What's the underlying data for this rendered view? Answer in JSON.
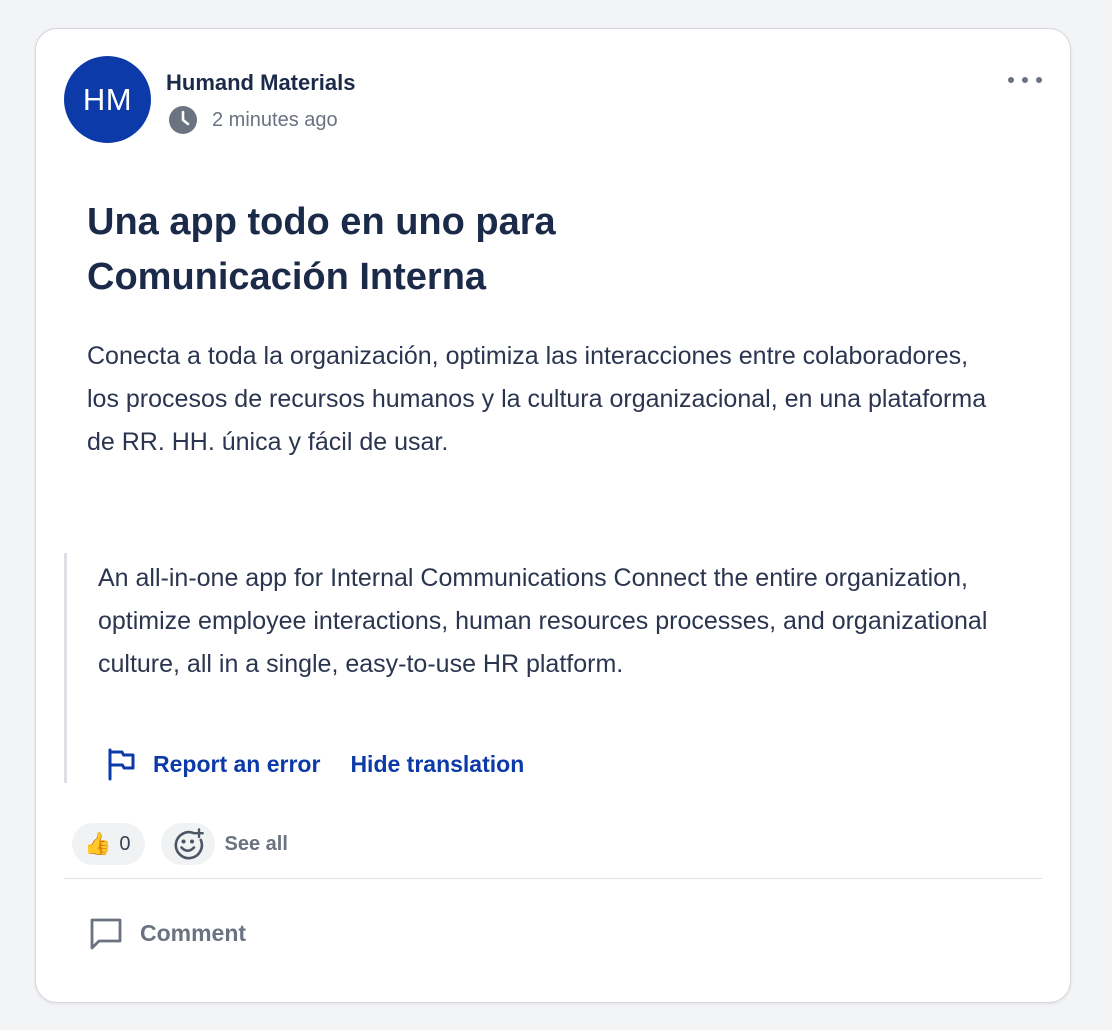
{
  "post": {
    "avatar_initials": "HM",
    "author": "Humand Materials",
    "timestamp": "2 minutes ago",
    "title_line1": "Una app todo en uno para",
    "title_line2": "Comunicación Interna",
    "body": "Conecta a toda la organización, optimiza las interacciones entre colaboradores, los procesos de recursos humanos y la cultura organizacional, en una plataforma de RR. HH. única y fácil de usar."
  },
  "translation": {
    "text": "An all-in-one app for Internal Communications Connect the entire organization, optimize employee interactions, human resources processes, and organizational culture, all in a single, easy-to-use HR platform.",
    "report_label": "Report an error",
    "hide_label": "Hide translation"
  },
  "reactions": {
    "thumbs_up_emoji": "👍",
    "thumbs_up_count": "0",
    "see_all_label": "See all"
  },
  "actions": {
    "comment_label": "Comment"
  },
  "icons": {
    "clock": "clock-icon",
    "more": "more-horizontal-icon",
    "flag": "flag-icon",
    "add_reaction": "add-reaction-icon",
    "comment": "comment-icon"
  },
  "colors": {
    "brand": "#0c3aa8",
    "text": "#1c2a4a",
    "muted": "#6b7280"
  }
}
